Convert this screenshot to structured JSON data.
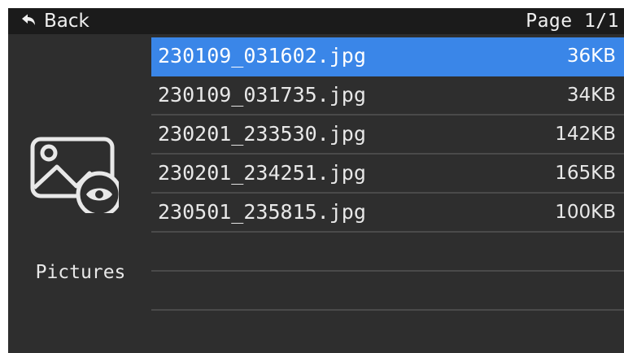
{
  "header": {
    "back_label": "Back",
    "page_indicator": "Page 1/1",
    "back_icon": "back-arrow-icon"
  },
  "sidebar": {
    "folder_label": "Pictures",
    "folder_icon": "image-viewer-icon"
  },
  "files": [
    {
      "name": "230109_031602.jpg",
      "size": "36KB",
      "selected": true
    },
    {
      "name": "230109_031735.jpg",
      "size": "34KB",
      "selected": false
    },
    {
      "name": "230201_233530.jpg",
      "size": "142KB",
      "selected": false
    },
    {
      "name": "230201_234251.jpg",
      "size": "165KB",
      "selected": false
    },
    {
      "name": "230501_235815.jpg",
      "size": "100KB",
      "selected": false
    }
  ],
  "colors": {
    "background": "#2e2e2e",
    "topbar": "#1b1b1b",
    "selection": "#3a86e8",
    "divider": "#4a4a4a",
    "text": "#e8e8e8"
  }
}
